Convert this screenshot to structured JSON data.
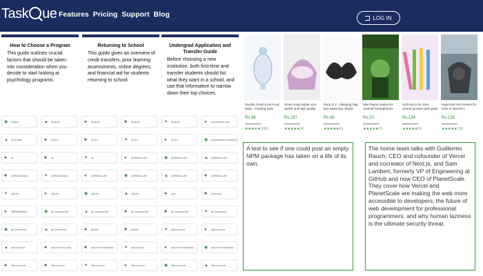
{
  "header": {
    "logo_text_left": "Task",
    "logo_text_right": "ue",
    "nav": [
      "Features",
      "Pricing",
      "Support",
      "Blog"
    ],
    "login_label": "LOG IN"
  },
  "cards": [
    {
      "title": "How to Choose a Program",
      "text": "This guide outlines crucial factors that should be taken into consideration when you decide to start looking at psychology programs."
    },
    {
      "title": "Returning to School",
      "text": "This guide gives an overview of credit transfers, prior learning assessments, online degrees, and financial aid for students returning to school."
    },
    {
      "title": "Undergrad Application and Transfer Guide",
      "text": "Before choosing a new institution, both first-time and transfer students should list what they want in a school, and use that information to narrow down their top choices."
    }
  ],
  "icon_grid": {
    "rows": [
      [
        "480px",
        "abacus",
        "abacus",
        "abacus",
        "abacus",
        "accessible-icon"
      ],
      [
        "accessib",
        "accou",
        "acorn",
        "acorn",
        "acorn",
        "acquisitions-incorporated"
      ],
      [
        "ad",
        "ad",
        "ad",
        "address-card",
        "address-card",
        "address-card"
      ],
      [
        "address-book",
        "address-book",
        "address-card",
        "address-card",
        "address-card",
        "address-card"
      ],
      [
        "adjust",
        "adjust",
        "adjust",
        "adjust",
        "adn",
        "adversal"
      ],
      [
        "affiliatetheme",
        "air-conditioner",
        "air-conditioner",
        "air-conditioner",
        "air-conditioner",
        "air-freshener"
      ],
      [
        "air-freshener",
        "air-freshener",
        "airbnb",
        "airbnb",
        "alarm-clock",
        "alarm-clock"
      ],
      [
        "alarm-clock",
        "alarm-clock-plus",
        "alarm-exclamation",
        "alarm-plus",
        "alarm-exclamation",
        "alarm-exclamation"
      ],
      [
        "album-circle",
        "album-plus",
        "album-plus",
        "album-plus",
        "album-circle",
        "album-circle"
      ]
    ]
  },
  "products": [
    {
      "title": "Pacifier Fresh Fruit Food Baby - Feeding Safe Fruit...",
      "price": "Rs.98",
      "old": "Rs.599 -84%",
      "stars": "★★★★★",
      "count": "(166)"
    },
    {
      "title": "Smart soap holder very stylish and high quality lea...",
      "price": "Rs.297",
      "old": "Rs.449 -34%",
      "stars": "★★★★★",
      "count": "(4)"
    },
    {
      "title": "Pack of 2 - Sleeping Nap Eye Mask Eye Shade Cove...",
      "price": "Rs.99",
      "old": "Rs.449 -78%",
      "stars": "★★★★★",
      "count": "(6)"
    },
    {
      "title": "Max Payne Game For Android Smartphones -...",
      "price": "Rs.20",
      "old": "Rs.150 -87%",
      "stars": "★★★★★",
      "count": "(2)"
    },
    {
      "title": "Soft Razor for Girls women private parts pack of 6",
      "price": "Rs.124",
      "old": "Rs.199 -38%",
      "stars": "★★★★★",
      "count": "(6)"
    },
    {
      "title": "Hand and Arm Gloves for Girls or Women | Muslim...",
      "price": "Rs.130",
      "old": "Rs.199 -35%",
      "stars": "★★★★★",
      "count": "(18)"
    }
  ],
  "textboxes": [
    {
      "text": "A test to see if one could post an empty NPM package has taken on a life of its own."
    },
    {
      "text": "The home team talks with Guillermo Rauch, CEO and cofounder of Vercel and cocreator of Next.js, and Sam Lambert, formerly VP of Engineering at GitHub and now CEO of PlanetScale. They cover how Vercel and PlanetScale are making the web more accessible to developers, the future of web development for professional programmers, and why human laziness is the ultimate security threat."
    }
  ],
  "colors": {
    "header_bg": "#1b2c5e",
    "accent_green": "#2e9b2e",
    "price_green": "#2d8a2d"
  }
}
